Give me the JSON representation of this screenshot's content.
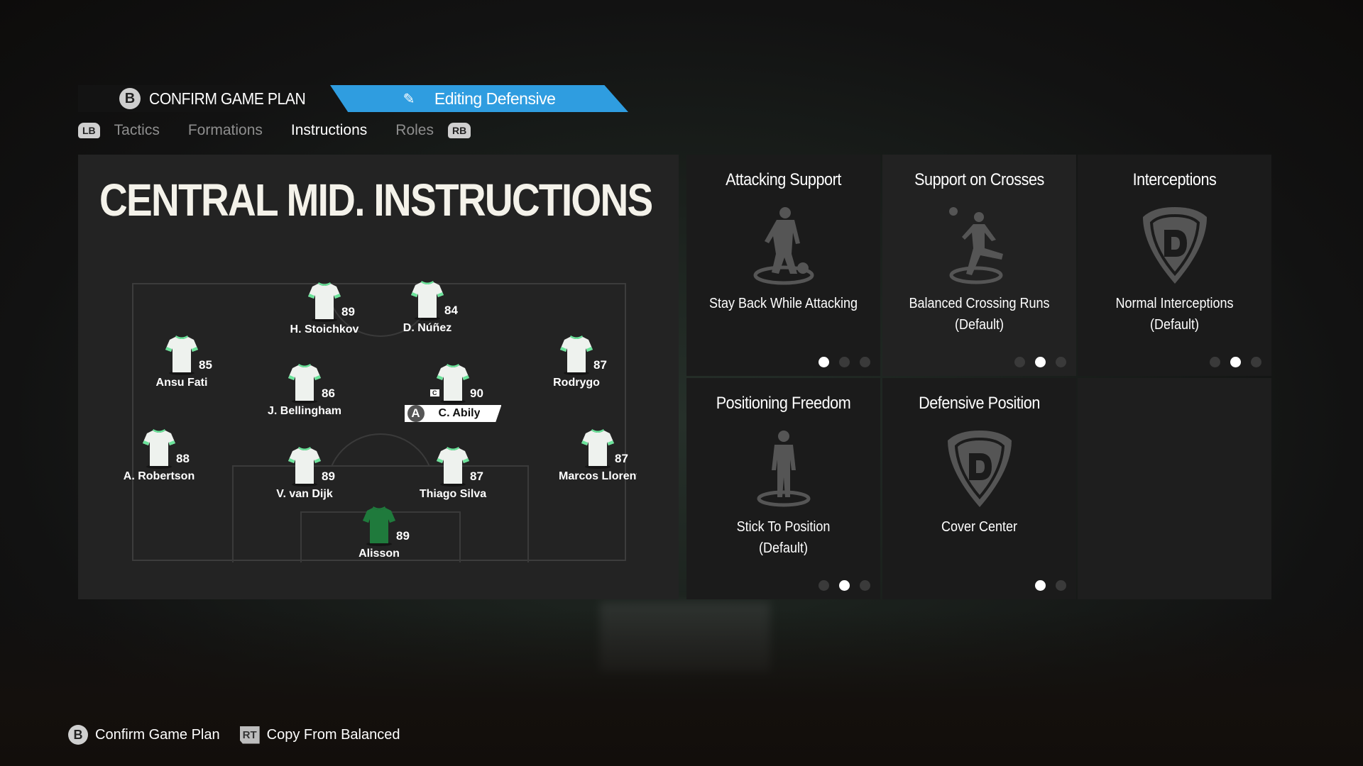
{
  "header": {
    "confirm_button_glyph": "B",
    "confirm_label": "CONFIRM GAME PLAN",
    "editing_label": "Editing Defensive",
    "accent_color": "#2f9de0"
  },
  "tabs": {
    "lb": "LB",
    "rb": "RB",
    "items": [
      "Tactics",
      "Formations",
      "Instructions",
      "Roles"
    ],
    "active": "Instructions"
  },
  "panel": {
    "title": "CENTRAL MID. INSTRUCTIONS"
  },
  "players": [
    {
      "name": "H. Stoichkov",
      "rating": "89"
    },
    {
      "name": "D. Núñez",
      "rating": "84"
    },
    {
      "name": "Ansu Fati",
      "rating": "85"
    },
    {
      "name": "Rodrygo",
      "rating": "87"
    },
    {
      "name": "J. Bellingham",
      "rating": "86"
    },
    {
      "name": "C. Abily",
      "rating": "90",
      "selected": true,
      "captain_badge": "C",
      "select_glyph": "A"
    },
    {
      "name": "A. Robertson",
      "rating": "88"
    },
    {
      "name": "Marcos Llorente",
      "rating": "87"
    },
    {
      "name": "V. van Dijk",
      "rating": "89"
    },
    {
      "name": "Thiago Silva",
      "rating": "87"
    },
    {
      "name": "Alisson",
      "rating": "89",
      "goalkeeper": true
    }
  ],
  "cards": [
    {
      "title": "Attacking Support",
      "value": "Stay Back While Attacking",
      "sub": "",
      "icon": "player-dribble-icon",
      "options": 3,
      "selected": 0
    },
    {
      "title": "Support on Crosses",
      "value": "Balanced Crossing Runs",
      "sub": "(Default)",
      "icon": "player-run-icon",
      "options": 3,
      "selected": 1
    },
    {
      "title": "Interceptions",
      "value": "Normal Interceptions",
      "sub": "(Default)",
      "icon": "defense-shield-icon",
      "options": 3,
      "selected": 1
    },
    {
      "title": "Positioning Freedom",
      "value": "Stick To Position",
      "sub": "(Default)",
      "icon": "player-standing-icon",
      "options": 3,
      "selected": 1
    },
    {
      "title": "Defensive Position",
      "value": "Cover Center",
      "sub": "",
      "icon": "defense-shield-icon",
      "options": 2,
      "selected": 0
    }
  ],
  "footer": {
    "b_glyph": "B",
    "confirm": "Confirm Game Plan",
    "rt_glyph": "RT",
    "copy": "Copy From Balanced"
  }
}
